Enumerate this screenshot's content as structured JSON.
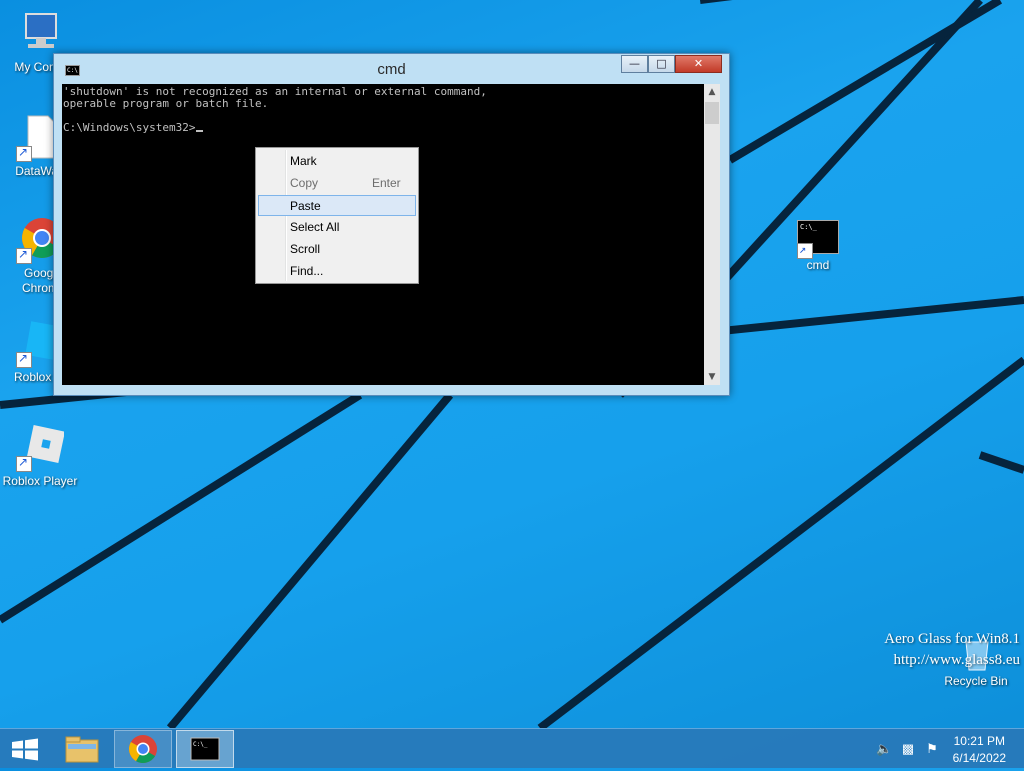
{
  "desktop": {
    "icons": [
      {
        "label": "My Comp",
        "icon": "computer-icon"
      },
      {
        "label": "DataWag",
        "icon": "document-icon"
      },
      {
        "label": "Googl",
        "label2": "Chrom",
        "icon": "chrome-icon"
      },
      {
        "label": "Roblox St",
        "icon": "roblox-studio-icon"
      },
      {
        "label": "Roblox Player",
        "icon": "roblox-player-icon"
      },
      {
        "label": "cmd",
        "icon": "cmd-icon"
      },
      {
        "label": "Recycle Bin",
        "icon": "recycle-bin-icon"
      }
    ],
    "watermark": {
      "line1": "Aero Glass for Win8.1",
      "line2": "http://www.glass8.eu"
    }
  },
  "window": {
    "title": "cmd",
    "console_lines": [
      "'shutdown' is not recognized as an internal or external command,",
      "operable program or batch file.",
      "",
      "C:\\Windows\\system32>"
    ]
  },
  "context_menu": {
    "items": [
      {
        "label": "Mark",
        "shortcut": "",
        "disabled": false
      },
      {
        "label": "Copy",
        "shortcut": "Enter",
        "disabled": true
      },
      {
        "label": "Paste",
        "shortcut": "",
        "disabled": false,
        "highlighted": true
      },
      {
        "label": "Select All",
        "shortcut": "",
        "disabled": false
      },
      {
        "label": "Scroll",
        "shortcut": "",
        "disabled": false
      },
      {
        "label": "Find...",
        "shortcut": "",
        "disabled": false
      }
    ]
  },
  "taskbar": {
    "buttons": [
      "start-icon",
      "file-explorer-icon",
      "chrome-icon",
      "cmd-icon"
    ],
    "tray": {
      "time": "10:21 PM",
      "date": "6/14/2022"
    }
  },
  "colors": {
    "console_bg": "#000000",
    "console_text": "#c0c0c0",
    "accent": "#1aa3ee"
  }
}
